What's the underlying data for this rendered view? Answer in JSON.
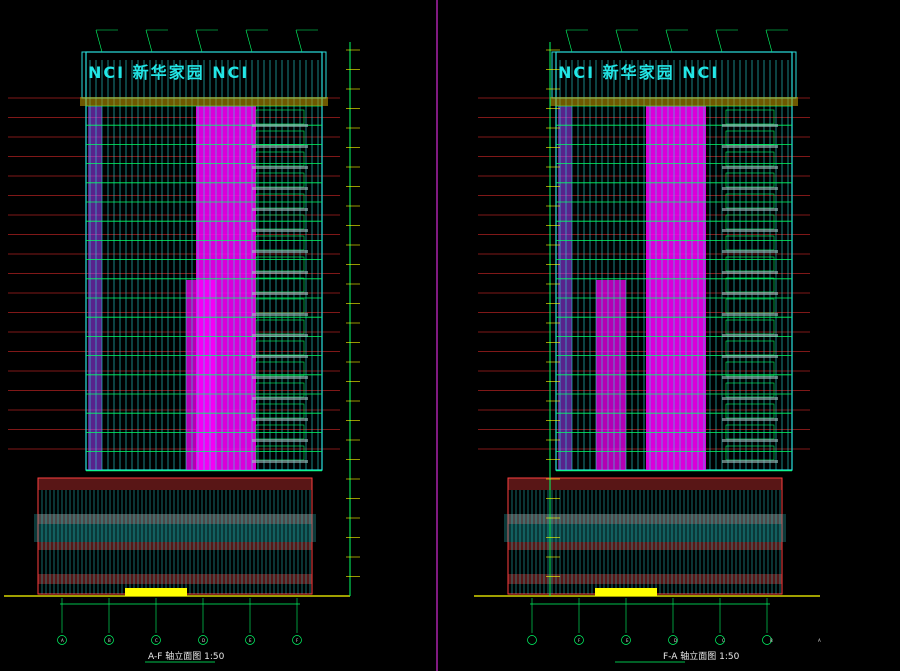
{
  "drawing": {
    "colors": {
      "background": "#000000",
      "frame_line": "#ff33ff",
      "curtain_wall": "#ff00ff",
      "glass": "#2adede",
      "grid": "#00ff66",
      "level_line": "#ff3030",
      "brick": "#ff4040",
      "ground": "#ffff00",
      "text": "#e8e8e8"
    },
    "elevations": [
      {
        "id": "left",
        "sign_text": "NCI 新华家园 NCI",
        "caption": "A-F 轴立面图 1:50",
        "axes": [
          "A",
          "B",
          "C",
          "D",
          "E",
          "F"
        ],
        "curtain_side": "left"
      },
      {
        "id": "right",
        "sign_text": "NCI 新华家园 NCI",
        "caption": "F-A 轴立面图 1:50",
        "axes": [
          "F",
          "E",
          "D",
          "C",
          "B",
          "A"
        ],
        "curtain_side": "right"
      }
    ]
  }
}
